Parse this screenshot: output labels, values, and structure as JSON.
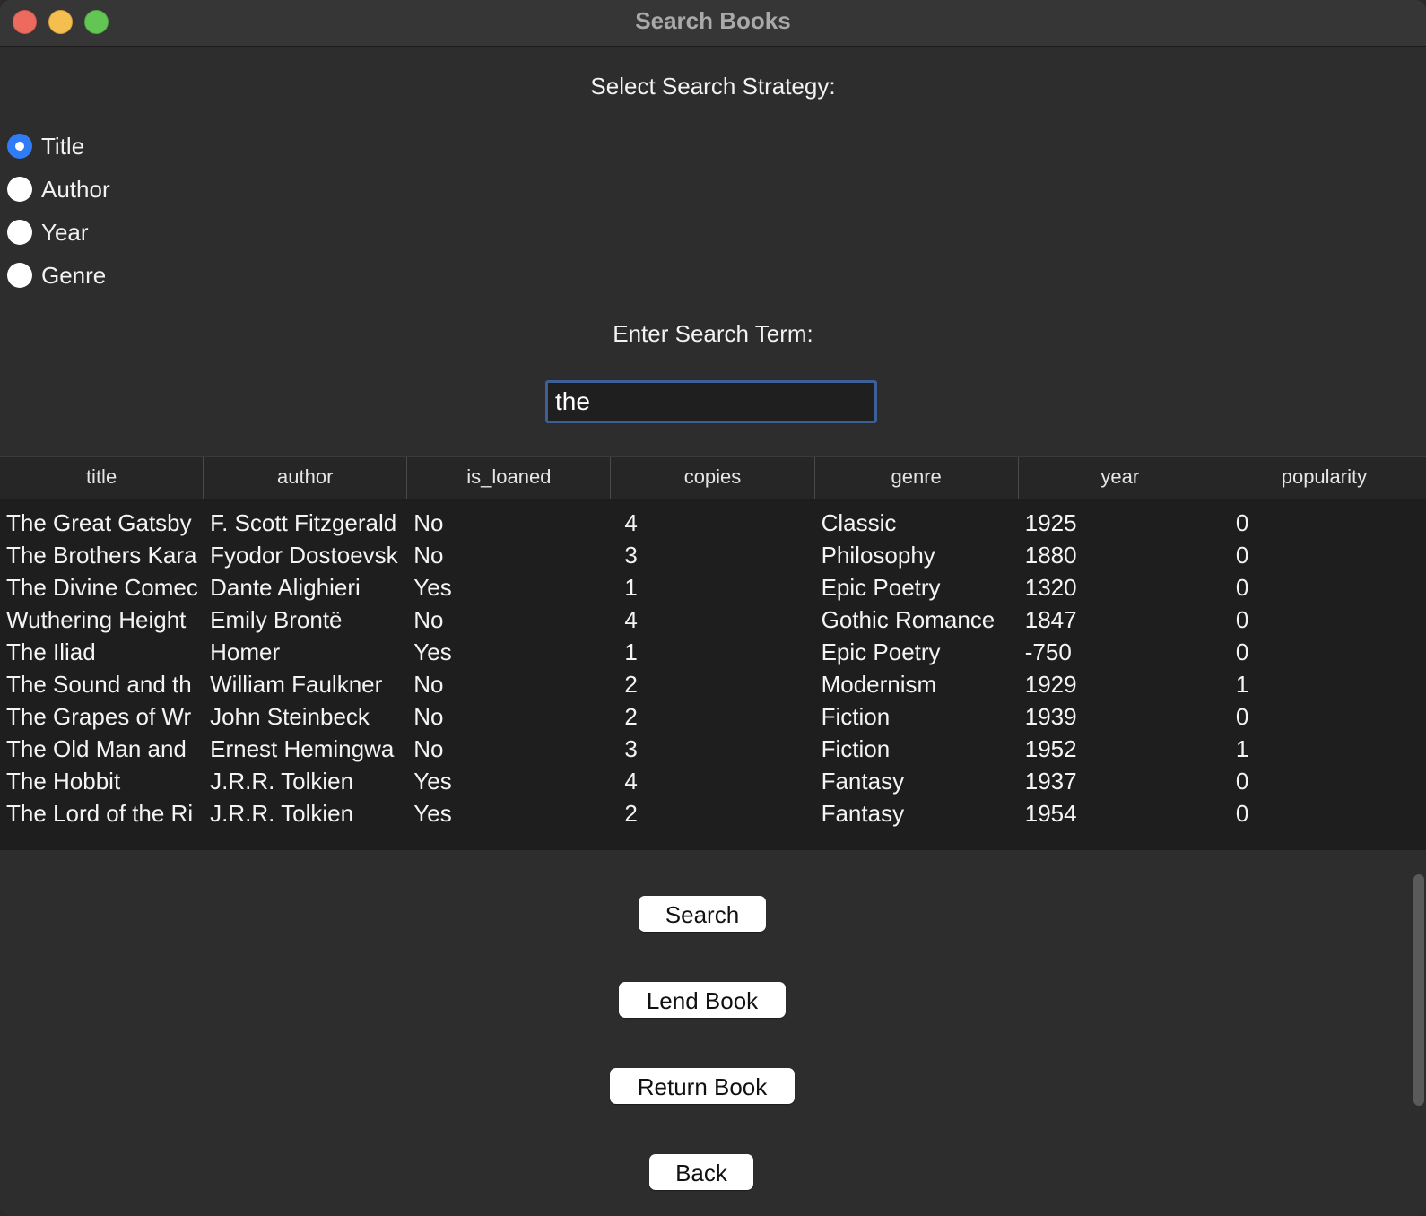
{
  "window": {
    "title": "Search Books"
  },
  "strategy": {
    "label": "Select Search Strategy:",
    "options": [
      {
        "label": "Title",
        "checked": true
      },
      {
        "label": "Author",
        "checked": false
      },
      {
        "label": "Year",
        "checked": false
      },
      {
        "label": "Genre",
        "checked": false
      }
    ]
  },
  "search": {
    "label": "Enter Search Term:",
    "value": "the"
  },
  "table": {
    "columns": [
      "title",
      "author",
      "is_loaned",
      "copies",
      "genre",
      "year",
      "popularity"
    ],
    "rows": [
      [
        "The Great Gatsby",
        "F. Scott Fitzgerald",
        "No",
        "4",
        "Classic",
        "1925",
        "0"
      ],
      [
        "The Brothers Kara",
        "Fyodor Dostoevsk",
        "No",
        "3",
        "Philosophy",
        "1880",
        "0"
      ],
      [
        "The Divine Comec",
        "Dante Alighieri",
        "Yes",
        "1",
        "Epic Poetry",
        "1320",
        "0"
      ],
      [
        "Wuthering Height",
        "Emily Brontë",
        "No",
        "4",
        "Gothic Romance",
        "1847",
        "0"
      ],
      [
        "The Iliad",
        "Homer",
        "Yes",
        "1",
        "Epic Poetry",
        "-750",
        "0"
      ],
      [
        "The Sound and th",
        "William Faulkner",
        "No",
        "2",
        "Modernism",
        "1929",
        "1"
      ],
      [
        "The Grapes of Wr",
        "John Steinbeck",
        "No",
        "2",
        "Fiction",
        "1939",
        "0"
      ],
      [
        "The Old Man and",
        "Ernest Hemingwa",
        "No",
        "3",
        "Fiction",
        "1952",
        "1"
      ],
      [
        "The Hobbit",
        "J.R.R. Tolkien",
        "Yes",
        "4",
        "Fantasy",
        "1937",
        "0"
      ],
      [
        "The Lord of the Ri",
        "J.R.R. Tolkien",
        "Yes",
        "2",
        "Fantasy",
        "1954",
        "0"
      ]
    ]
  },
  "buttons": {
    "search": "Search",
    "lend": "Lend Book",
    "return": "Return Book",
    "back": "Back"
  },
  "colors": {
    "radio_checked": "#2f7cf6",
    "input_focus_border": "#3d5f98",
    "background": "#2d2d2d",
    "table_background": "#1e1e1e"
  }
}
